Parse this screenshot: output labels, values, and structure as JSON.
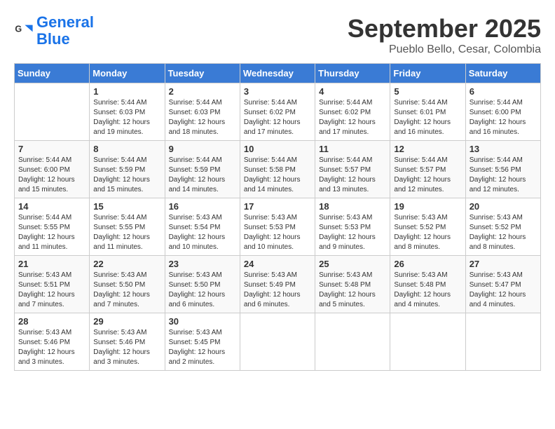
{
  "header": {
    "logo_general": "General",
    "logo_blue": "Blue",
    "month": "September 2025",
    "location": "Pueblo Bello, Cesar, Colombia"
  },
  "weekdays": [
    "Sunday",
    "Monday",
    "Tuesday",
    "Wednesday",
    "Thursday",
    "Friday",
    "Saturday"
  ],
  "weeks": [
    [
      {
        "day": "",
        "info": ""
      },
      {
        "day": "1",
        "info": "Sunrise: 5:44 AM\nSunset: 6:03 PM\nDaylight: 12 hours\nand 19 minutes."
      },
      {
        "day": "2",
        "info": "Sunrise: 5:44 AM\nSunset: 6:03 PM\nDaylight: 12 hours\nand 18 minutes."
      },
      {
        "day": "3",
        "info": "Sunrise: 5:44 AM\nSunset: 6:02 PM\nDaylight: 12 hours\nand 17 minutes."
      },
      {
        "day": "4",
        "info": "Sunrise: 5:44 AM\nSunset: 6:02 PM\nDaylight: 12 hours\nand 17 minutes."
      },
      {
        "day": "5",
        "info": "Sunrise: 5:44 AM\nSunset: 6:01 PM\nDaylight: 12 hours\nand 16 minutes."
      },
      {
        "day": "6",
        "info": "Sunrise: 5:44 AM\nSunset: 6:00 PM\nDaylight: 12 hours\nand 16 minutes."
      }
    ],
    [
      {
        "day": "7",
        "info": "Sunrise: 5:44 AM\nSunset: 6:00 PM\nDaylight: 12 hours\nand 15 minutes."
      },
      {
        "day": "8",
        "info": "Sunrise: 5:44 AM\nSunset: 5:59 PM\nDaylight: 12 hours\nand 15 minutes."
      },
      {
        "day": "9",
        "info": "Sunrise: 5:44 AM\nSunset: 5:59 PM\nDaylight: 12 hours\nand 14 minutes."
      },
      {
        "day": "10",
        "info": "Sunrise: 5:44 AM\nSunset: 5:58 PM\nDaylight: 12 hours\nand 14 minutes."
      },
      {
        "day": "11",
        "info": "Sunrise: 5:44 AM\nSunset: 5:57 PM\nDaylight: 12 hours\nand 13 minutes."
      },
      {
        "day": "12",
        "info": "Sunrise: 5:44 AM\nSunset: 5:57 PM\nDaylight: 12 hours\nand 12 minutes."
      },
      {
        "day": "13",
        "info": "Sunrise: 5:44 AM\nSunset: 5:56 PM\nDaylight: 12 hours\nand 12 minutes."
      }
    ],
    [
      {
        "day": "14",
        "info": "Sunrise: 5:44 AM\nSunset: 5:55 PM\nDaylight: 12 hours\nand 11 minutes."
      },
      {
        "day": "15",
        "info": "Sunrise: 5:44 AM\nSunset: 5:55 PM\nDaylight: 12 hours\nand 11 minutes."
      },
      {
        "day": "16",
        "info": "Sunrise: 5:43 AM\nSunset: 5:54 PM\nDaylight: 12 hours\nand 10 minutes."
      },
      {
        "day": "17",
        "info": "Sunrise: 5:43 AM\nSunset: 5:53 PM\nDaylight: 12 hours\nand 10 minutes."
      },
      {
        "day": "18",
        "info": "Sunrise: 5:43 AM\nSunset: 5:53 PM\nDaylight: 12 hours\nand 9 minutes."
      },
      {
        "day": "19",
        "info": "Sunrise: 5:43 AM\nSunset: 5:52 PM\nDaylight: 12 hours\nand 8 minutes."
      },
      {
        "day": "20",
        "info": "Sunrise: 5:43 AM\nSunset: 5:52 PM\nDaylight: 12 hours\nand 8 minutes."
      }
    ],
    [
      {
        "day": "21",
        "info": "Sunrise: 5:43 AM\nSunset: 5:51 PM\nDaylight: 12 hours\nand 7 minutes."
      },
      {
        "day": "22",
        "info": "Sunrise: 5:43 AM\nSunset: 5:50 PM\nDaylight: 12 hours\nand 7 minutes."
      },
      {
        "day": "23",
        "info": "Sunrise: 5:43 AM\nSunset: 5:50 PM\nDaylight: 12 hours\nand 6 minutes."
      },
      {
        "day": "24",
        "info": "Sunrise: 5:43 AM\nSunset: 5:49 PM\nDaylight: 12 hours\nand 6 minutes."
      },
      {
        "day": "25",
        "info": "Sunrise: 5:43 AM\nSunset: 5:48 PM\nDaylight: 12 hours\nand 5 minutes."
      },
      {
        "day": "26",
        "info": "Sunrise: 5:43 AM\nSunset: 5:48 PM\nDaylight: 12 hours\nand 4 minutes."
      },
      {
        "day": "27",
        "info": "Sunrise: 5:43 AM\nSunset: 5:47 PM\nDaylight: 12 hours\nand 4 minutes."
      }
    ],
    [
      {
        "day": "28",
        "info": "Sunrise: 5:43 AM\nSunset: 5:46 PM\nDaylight: 12 hours\nand 3 minutes."
      },
      {
        "day": "29",
        "info": "Sunrise: 5:43 AM\nSunset: 5:46 PM\nDaylight: 12 hours\nand 3 minutes."
      },
      {
        "day": "30",
        "info": "Sunrise: 5:43 AM\nSunset: 5:45 PM\nDaylight: 12 hours\nand 2 minutes."
      },
      {
        "day": "",
        "info": ""
      },
      {
        "day": "",
        "info": ""
      },
      {
        "day": "",
        "info": ""
      },
      {
        "day": "",
        "info": ""
      }
    ]
  ]
}
